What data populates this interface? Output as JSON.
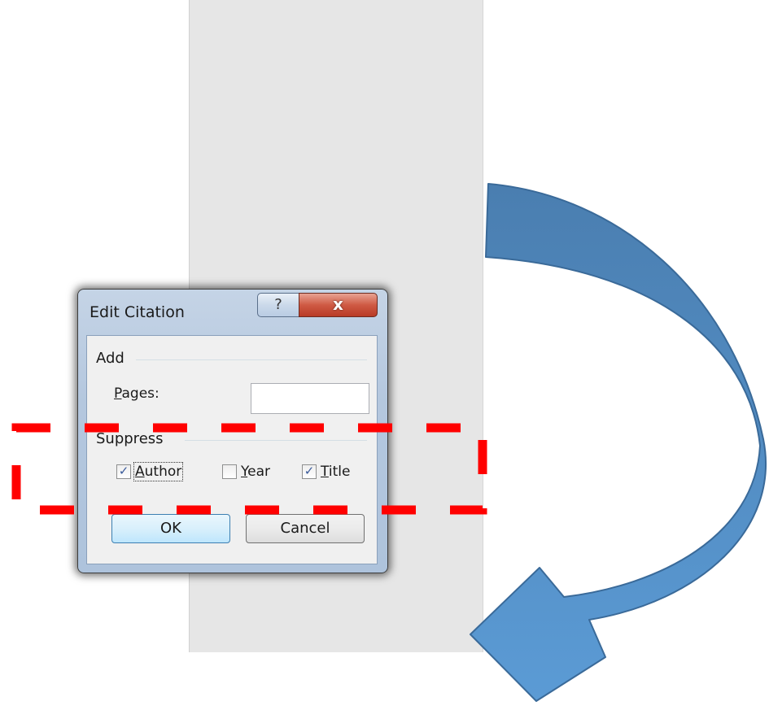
{
  "dialog": {
    "title": "Edit Citation",
    "help_icon": "question-mark-icon",
    "help_glyph": "?",
    "close_icon": "close-x-icon",
    "close_glyph": "x",
    "add_group": {
      "label": "Add",
      "pages_label_accel": "P",
      "pages_label_rest": "ages:",
      "pages_value": ""
    },
    "suppress_group": {
      "label": "Suppress",
      "items": [
        {
          "accel": "A",
          "rest": "uthor",
          "checked": true
        },
        {
          "accel": "Y",
          "rest": "ear",
          "checked": false
        },
        {
          "accel": "T",
          "rest": "itle",
          "checked": true
        }
      ]
    },
    "ok_label": "OK",
    "cancel_label": "Cancel"
  },
  "annotations": {
    "highlight_color": "#ff0000",
    "arrow_color_top": "#4a7eb0",
    "arrow_color_bottom": "#5b9bd5"
  }
}
